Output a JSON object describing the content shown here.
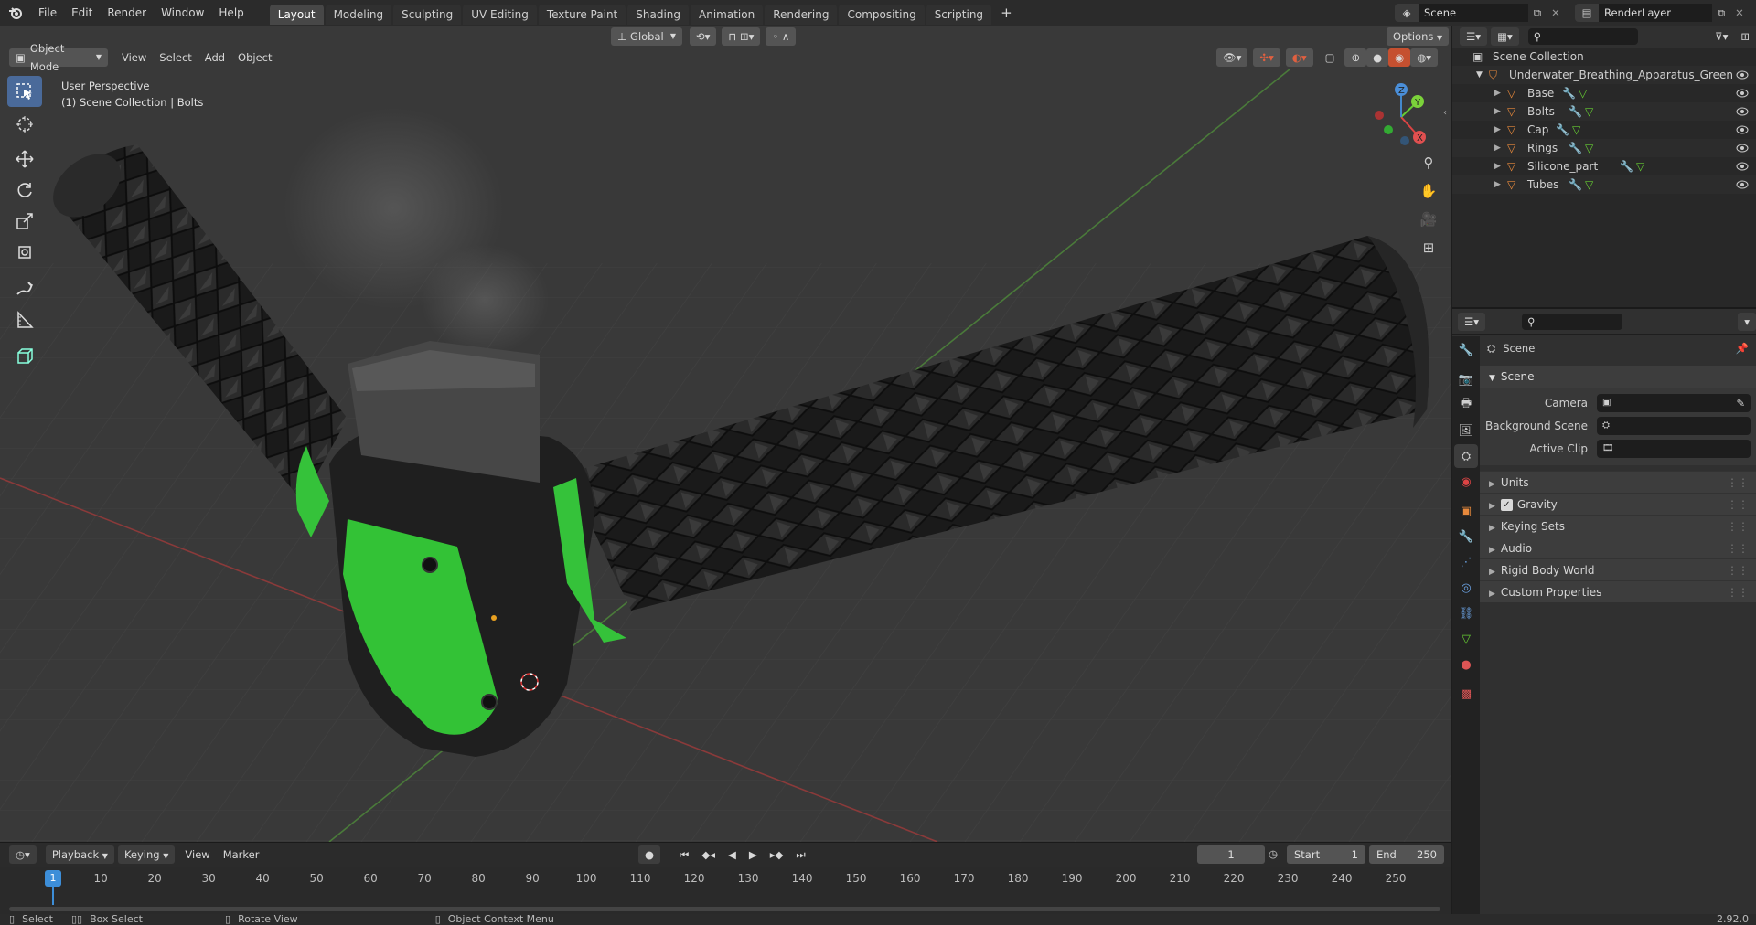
{
  "topbar": {
    "menus": [
      "File",
      "Edit",
      "Render",
      "Window",
      "Help"
    ],
    "workspaces": [
      "Layout",
      "Modeling",
      "Sculpting",
      "UV Editing",
      "Texture Paint",
      "Shading",
      "Animation",
      "Rendering",
      "Compositing",
      "Scripting"
    ],
    "active_workspace": "Layout",
    "add_tab": "+",
    "scene": "Scene",
    "view_layer": "RenderLayer"
  },
  "viewport": {
    "mode": "Object Mode",
    "menus": [
      "View",
      "Select",
      "Add",
      "Object"
    ],
    "transform_orientation": "Global",
    "options_label": "Options",
    "overlay_title": "User Perspective",
    "overlay_subtitle": "(1) Scene Collection | Bolts",
    "gizmo": {
      "x": "X",
      "y": "Y",
      "z": "Z"
    },
    "colors": {
      "background": "#393939",
      "accent_green": "#35c23a",
      "grid": "#414141",
      "axis_x": "#8a3a3a",
      "axis_y": "#4a7a3a"
    }
  },
  "outliner": {
    "root": "Scene Collection",
    "collection": "Underwater_Breathing_Apparatus_Green",
    "objects": [
      "Base",
      "Bolts",
      "Cap",
      "Rings",
      "Silicone_part",
      "Tubes"
    ]
  },
  "properties": {
    "context": "Scene",
    "panel_title": "Scene",
    "fields": [
      {
        "label": "Camera"
      },
      {
        "label": "Background Scene"
      },
      {
        "label": "Active Clip"
      }
    ],
    "subpanels": [
      "Units",
      "Gravity",
      "Keying Sets",
      "Audio",
      "Rigid Body World",
      "Custom Properties"
    ],
    "gravity_checked": true
  },
  "timeline": {
    "menus": [
      "Playback",
      "Keying",
      "View",
      "Marker"
    ],
    "current_frame": "1",
    "start_label": "Start",
    "start": "1",
    "end_label": "End",
    "end": "250",
    "ticks": [
      "10",
      "20",
      "30",
      "40",
      "50",
      "60",
      "70",
      "80",
      "90",
      "100",
      "110",
      "120",
      "130",
      "140",
      "150",
      "160",
      "170",
      "180",
      "190",
      "200",
      "210",
      "220",
      "230",
      "240",
      "250"
    ],
    "playhead": "1"
  },
  "statusbar": {
    "select": "Select",
    "box_select": "Box Select",
    "rotate_view": "Rotate View",
    "context_menu": "Object Context Menu",
    "version": "2.92.0"
  }
}
